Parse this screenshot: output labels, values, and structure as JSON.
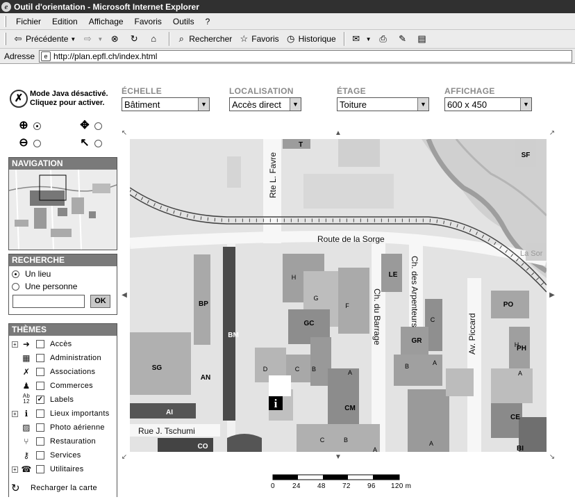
{
  "window": {
    "title": "Outil d'orientation - Microsoft Internet Explorer"
  },
  "menubar": {
    "items": [
      "Fichier",
      "Edition",
      "Affichage",
      "Favoris",
      "Outils",
      "?"
    ]
  },
  "toolbar": {
    "back": "Précédente",
    "search": "Rechercher",
    "favorites": "Favoris",
    "history": "Historique"
  },
  "addressbar": {
    "label": "Adresse",
    "url": "http://plan.epfl.ch/index.html"
  },
  "java_notice": {
    "line1": "Mode Java désactivé.",
    "line2": "Cliquez pour activer."
  },
  "controls": {
    "echelle": {
      "label": "ÉCHELLE",
      "value": "Bâtiment"
    },
    "localisation": {
      "label": "LOCALISATION",
      "value": "Accès direct"
    },
    "etage": {
      "label": "ÉTAGE",
      "value": "Toiture"
    },
    "affichage": {
      "label": "AFFICHAGE",
      "value": "600 x 450"
    }
  },
  "tools": {
    "zoom_in": {
      "icon": "zoom-in-icon",
      "selected": true
    },
    "zoom_out": {
      "icon": "zoom-out-icon",
      "selected": false
    },
    "pan": {
      "icon": "move-icon",
      "selected": false
    },
    "info": {
      "icon": "info-cursor-icon",
      "selected": false
    }
  },
  "navigation": {
    "title": "NAVIGATION"
  },
  "search": {
    "title": "RECHERCHE",
    "option_place": "Un lieu",
    "option_person": "Une personne",
    "selected": "place",
    "input_value": "",
    "button": "OK"
  },
  "themes": {
    "title": "THÈMES",
    "items": [
      {
        "label": "Accès",
        "icon": "arrow-icon",
        "expandable": true,
        "checked": false
      },
      {
        "label": "Administration",
        "icon": "building-icon",
        "expandable": false,
        "checked": false
      },
      {
        "label": "Associations",
        "icon": "person-icon",
        "expandable": false,
        "checked": false
      },
      {
        "label": "Commerces",
        "icon": "shopping-icon",
        "expandable": false,
        "checked": false
      },
      {
        "label": "Labels",
        "icon": "labels-icon",
        "icon_text": "Ab 12",
        "expandable": false,
        "checked": true
      },
      {
        "label": "Lieux importants",
        "icon": "info-icon",
        "expandable": true,
        "checked": false
      },
      {
        "label": "Photo aérienne",
        "icon": "photo-icon",
        "expandable": false,
        "checked": false
      },
      {
        "label": "Restauration",
        "icon": "cutlery-icon",
        "expandable": false,
        "checked": false
      },
      {
        "label": "Services",
        "icon": "key-icon",
        "expandable": false,
        "checked": false
      },
      {
        "label": "Utilitaires",
        "icon": "phone-icon",
        "expandable": true,
        "checked": false
      }
    ],
    "reload": "Recharger la carte"
  },
  "map": {
    "streets": [
      "Route de la Sorge",
      "Rte L. Favre",
      "Ch. des Arpenteurs",
      "Ch. du Barrage",
      "Av. Piccard",
      "Rue J. Tschumi",
      "La Sor"
    ],
    "buildings": [
      "T",
      "SF",
      "LE",
      "H",
      "G",
      "F",
      "BP",
      "BM",
      "GC",
      "C",
      "GR",
      "PO",
      "PH",
      "H",
      "SG",
      "AN",
      "D",
      "C",
      "B",
      "A",
      "B",
      "A",
      "CM",
      "AI",
      "CO",
      "C",
      "B",
      "A",
      "A",
      "CE",
      "A",
      "BI",
      "A"
    ],
    "colors": {
      "background": "#e3e3e3",
      "road": "#f7f7f7",
      "building_light": "#c4c4c4",
      "building_mid": "#a9a9a9",
      "building_dark": "#4a4a4a",
      "river": "#9e9e9e"
    }
  },
  "scale": {
    "ticks": [
      "0",
      "24",
      "48",
      "72",
      "96",
      "120 m"
    ]
  }
}
